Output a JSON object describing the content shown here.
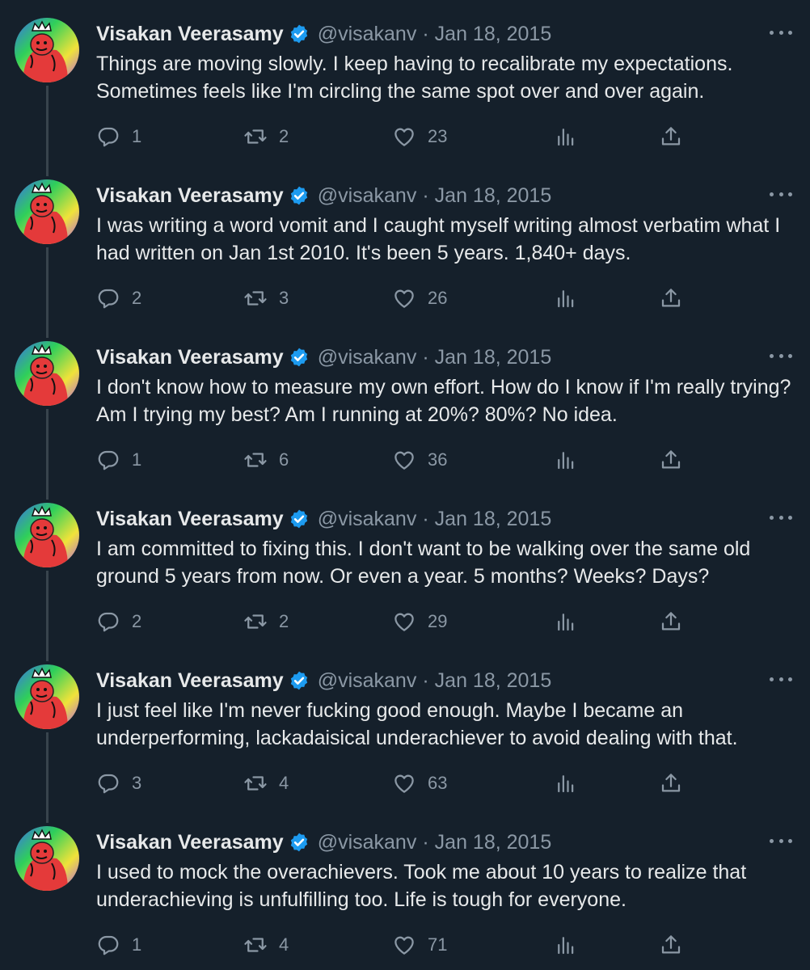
{
  "author": {
    "name": "Visakan Veerasamy",
    "handle": "@visakanv"
  },
  "separator": "·",
  "tweets": [
    {
      "date": "Jan 18, 2015",
      "text": "Things are moving slowly. I keep having to recalibrate my expectations. Sometimes feels like I'm circling the same spot over and over again.",
      "replies": "1",
      "retweets": "2",
      "likes": "23"
    },
    {
      "date": "Jan 18, 2015",
      "text": "I was writing a word vomit and I caught myself writing almost verbatim what I had written on Jan 1st 2010. It's been 5 years. 1,840+ days.",
      "replies": "2",
      "retweets": "3",
      "likes": "26"
    },
    {
      "date": "Jan 18, 2015",
      "text": "I don't know how to measure my own effort. How do I know if I'm really trying? Am I trying my best? Am I running at 20%? 80%? No idea.",
      "replies": "1",
      "retweets": "6",
      "likes": "36"
    },
    {
      "date": "Jan 18, 2015",
      "text": "I am committed to fixing this. I don't want to be walking over the same old ground 5 years from now. Or even a year. 5 months? Weeks? Days?",
      "replies": "2",
      "retweets": "2",
      "likes": "29"
    },
    {
      "date": "Jan 18, 2015",
      "text": "I just feel like I'm never fucking good enough. Maybe I became an underperforming, lackadaisical underachiever to avoid dealing with that.",
      "replies": "3",
      "retweets": "4",
      "likes": "63"
    },
    {
      "date": "Jan 18, 2015",
      "text": "I used to mock the overachievers. Took me about 10 years to realize that underachieving is unfulfilling too. Life is tough for everyone.",
      "replies": "1",
      "retweets": "4",
      "likes": "71"
    }
  ],
  "icons": {
    "reply": "speech-bubble-icon",
    "retweet": "retweet-arrows-icon",
    "like": "heart-icon",
    "views": "bar-chart-icon",
    "share": "upload-arrow-icon",
    "more": "three-dots-icon",
    "verified": "verified-badge-icon"
  },
  "colors": {
    "background": "#15202b",
    "text": "#e7e9ea",
    "secondary": "#8b98a5",
    "verified": "#1d9bf0",
    "thread_line": "#38444d"
  }
}
